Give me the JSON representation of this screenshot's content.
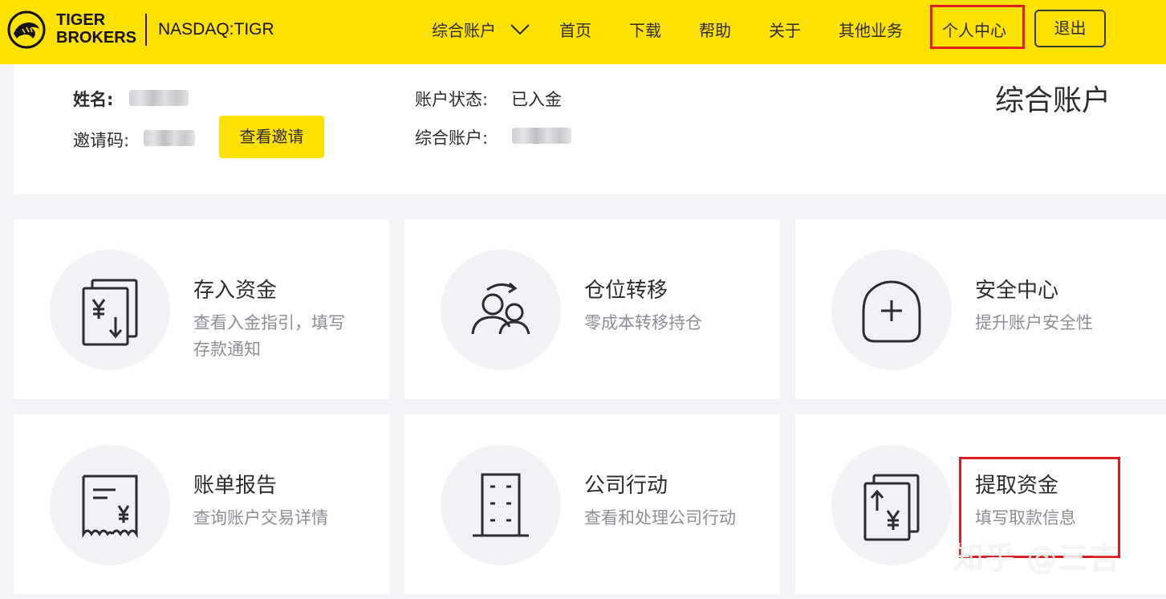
{
  "header": {
    "brand_line1": "TIGER",
    "brand_line2": "BROKERS",
    "ticker": "NASDAQ:TIGR",
    "nav": {
      "account_dropdown": "综合账户",
      "home": "首页",
      "download": "下载",
      "help": "帮助",
      "about": "关于",
      "other_business": "其他业务",
      "personal_center": "个人中心",
      "logout": "退出"
    },
    "colors": {
      "bar": "#ffe100",
      "highlight": "#e02020"
    }
  },
  "info": {
    "name_label": "姓名:",
    "invite_label": "邀请码:",
    "invite_button": "查看邀请",
    "status_label": "账户状态:",
    "status_value": "已入金",
    "account_label": "综合账户:",
    "panel_title": "综合账户"
  },
  "cards": [
    {
      "icon": "deposit-icon",
      "title": "存入资金",
      "desc": "查看入金指引，填写存款通知"
    },
    {
      "icon": "transfer-users-icon",
      "title": "仓位转移",
      "desc": "零成本转移持仓"
    },
    {
      "icon": "shield-plus-icon",
      "title": "安全中心",
      "desc": "提升账户安全性"
    },
    {
      "icon": "receipt-icon",
      "title": "账单报告",
      "desc": "查询账户交易详情"
    },
    {
      "icon": "building-icon",
      "title": "公司行动",
      "desc": "查看和处理公司行动"
    },
    {
      "icon": "withdraw-icon",
      "title": "提取资金",
      "desc": "填写取款信息"
    }
  ],
  "watermark": "知乎 @三吉"
}
